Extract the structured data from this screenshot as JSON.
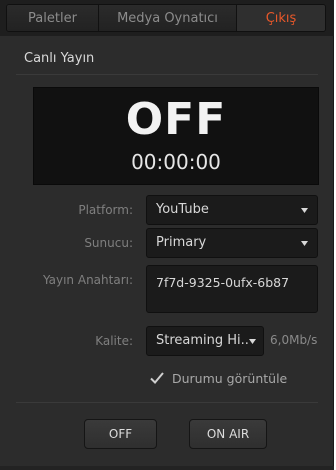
{
  "tabs": [
    {
      "label": "Paletler",
      "active": false
    },
    {
      "label": "Medya Oynatıcı",
      "active": false
    },
    {
      "label": "Çıkış",
      "active": true
    }
  ],
  "colors": {
    "accent": "#e8582a",
    "panel": "#2c2c2c",
    "field": "#1b1b1b"
  },
  "section": {
    "title": "Canlı Yayın"
  },
  "status": {
    "state": "OFF",
    "time": "00:00:00"
  },
  "form": {
    "platform": {
      "label": "Platform:",
      "value": "YouTube"
    },
    "server": {
      "label": "Sunucu:",
      "value": "Primary"
    },
    "stream_key": {
      "label": "Yayın Anahtarı:",
      "value": "7f7d-9325-0ufx-6b87"
    },
    "quality": {
      "label": "Kalite:",
      "value": "Streaming Hi...",
      "bitrate": "6,0Mb/s"
    },
    "show_status": {
      "label": "Durumu görüntüle",
      "checked": true
    }
  },
  "buttons": {
    "off": "OFF",
    "on_air": "ON AIR"
  },
  "icons": {
    "dropdown": "chevron-down-icon",
    "check": "checkmark-icon"
  }
}
